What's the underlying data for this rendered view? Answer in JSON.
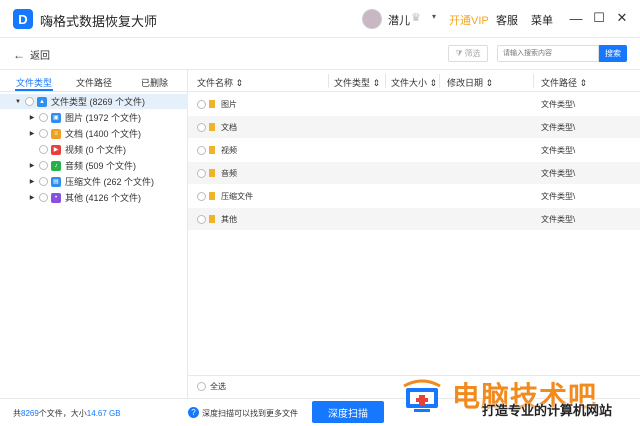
{
  "app": {
    "logo_letter": "D",
    "title": "嗨格式数据恢复大师"
  },
  "user": {
    "name": "潜儿",
    "crown": "♛",
    "caret": "▾"
  },
  "header": {
    "vip_label": "开通VIP",
    "service_label": "客服",
    "menu_label": "菜单"
  },
  "window": {
    "minimize": "—",
    "maximize": "☐",
    "close": "✕"
  },
  "toolbar": {
    "back_label": "返回",
    "back_arrow": "←",
    "filter_label": "筛选",
    "search_placeholder": "请输入搜索内容",
    "search_button": "搜索"
  },
  "left_tabs": [
    {
      "label": "文件类型",
      "active": true
    },
    {
      "label": "文件路径",
      "active": false
    },
    {
      "label": "已删除",
      "active": false
    }
  ],
  "tree": {
    "root": {
      "label": "文件类型 (8269 个文件)",
      "icon": "folder-icon"
    },
    "children": [
      {
        "label": "图片 (1972 个文件)",
        "icon": "image-icon",
        "color": "#2f8ef2",
        "expandable": true
      },
      {
        "label": "文档 (1400 个文件)",
        "icon": "document-icon",
        "color": "#f0a020",
        "expandable": true
      },
      {
        "label": "视频 (0 个文件)",
        "icon": "video-icon",
        "color": "#e8413a",
        "expandable": false
      },
      {
        "label": "音频 (509 个文件)",
        "icon": "audio-icon",
        "color": "#26b04a",
        "expandable": true
      },
      {
        "label": "压缩文件 (262 个文件)",
        "icon": "archive-icon",
        "color": "#2f8ef2",
        "expandable": true
      },
      {
        "label": "其他 (4126 个文件)",
        "icon": "other-icon",
        "color": "#8a4fe0",
        "expandable": true
      }
    ]
  },
  "table": {
    "columns": [
      "文件名称",
      "文件类型",
      "文件大小",
      "修改日期",
      "文件路径"
    ],
    "rows": [
      {
        "name": "图片",
        "path": "文件类型\\"
      },
      {
        "name": "文档",
        "path": "文件类型\\"
      },
      {
        "name": "视频",
        "path": "文件类型\\"
      },
      {
        "name": "音频",
        "path": "文件类型\\"
      },
      {
        "name": "压缩文件",
        "path": "文件类型\\"
      },
      {
        "name": "其他",
        "path": "文件类型\\"
      }
    ],
    "select_all": "全选"
  },
  "status": {
    "prefix": "共",
    "file_count": "8269",
    "middle": "个文件，大小",
    "size": "14.67 GB",
    "help_glyph": "?",
    "hint": "深度扫描可以找到更多文件",
    "deep_scan_button": "深度扫描"
  },
  "watermark": {
    "title": "电脑技术吧",
    "subtitle": "打造专业的计算机网站"
  },
  "colors": {
    "accent": "#1677ff",
    "vip": "#f5a623",
    "folder": "#f0b429",
    "watermark": "#f28a1e"
  }
}
